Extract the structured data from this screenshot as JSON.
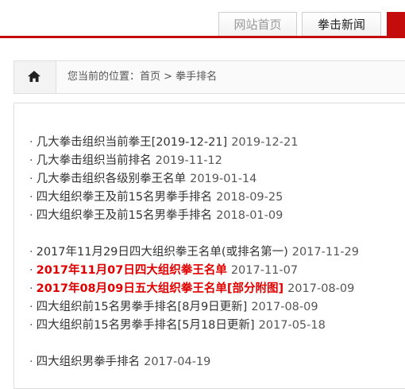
{
  "nav": {
    "tabs": [
      {
        "label": "网站首页"
      },
      {
        "label": "拳击新闻"
      }
    ]
  },
  "breadcrumb": {
    "text": "您当前的位置：首页 > 拳手排名"
  },
  "groups": [
    [
      {
        "title": "几大拳击组织当前拳王[2019-12-21]",
        "date": "2019-12-21"
      },
      {
        "title": "几大拳击组织当前排名",
        "date": "2019-11-12"
      },
      {
        "title": "几大拳击组织各级别拳王名单",
        "date": "2019-01-14"
      },
      {
        "title": "四大组织拳王及前15名男拳手排名",
        "date": "2018-09-25"
      },
      {
        "title": "四大组织拳王及前15名男拳手排名",
        "date": "2018-01-09"
      }
    ],
    [
      {
        "title": "2017年11月29日四大组织拳王名单(或排名第一)",
        "date": "2017-11-29"
      },
      {
        "title": "2017年11月07日四大组织拳王名单",
        "date": "2017-11-07",
        "highlight": true
      },
      {
        "title": "2017年08月09日五大组织拳王名单[部分附图]",
        "date": "2017-08-09",
        "highlight": true
      },
      {
        "title": "四大组织前15名男拳手排名[8月9日更新]",
        "date": "2017-08-09"
      },
      {
        "title": "四大组织前15名男拳手排名[5月18日更新]",
        "date": "2017-05-18"
      }
    ],
    [
      {
        "title": "四大组织男拳手排名",
        "date": "2017-04-19"
      }
    ]
  ],
  "colors": {
    "accent_red": "#c40c0c",
    "highlight_red": "#e00000"
  }
}
